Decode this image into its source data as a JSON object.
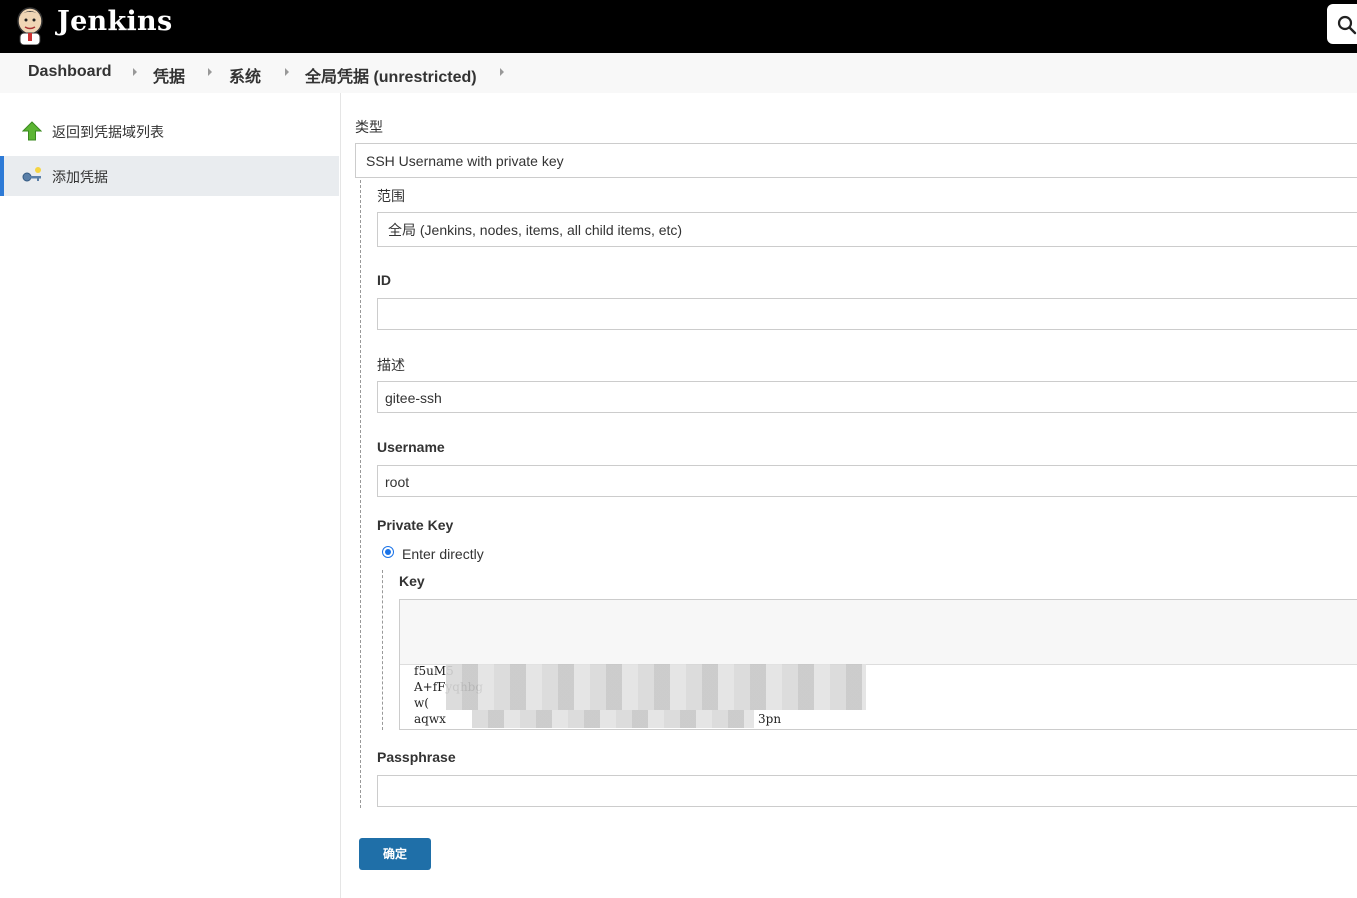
{
  "header": {
    "brand": "Jenkins"
  },
  "breadcrumb": {
    "items": [
      "Dashboard",
      "凭据",
      "系统",
      "全局凭据 (unrestricted)"
    ]
  },
  "sidebar": {
    "items": [
      {
        "label": "返回到凭据域列表",
        "icon": "up-arrow-icon"
      },
      {
        "label": "添加凭据",
        "icon": "key-icon",
        "active": true
      }
    ]
  },
  "form": {
    "kind_label": "类型",
    "kind_value": "SSH Username with private key",
    "scope_label": "范围",
    "scope_value": "全局 (Jenkins, nodes, items, all child items, etc)",
    "id_label": "ID",
    "id_value": "",
    "description_label": "描述",
    "description_value": "gitee-ssh",
    "username_label": "Username",
    "username_value": "root",
    "private_key_label": "Private Key",
    "enter_directly_label": "Enter directly",
    "key_label": "Key",
    "key_lines": [
      "f5uM5",
      "A+fFyqhbg",
      "w(",
      "aqwx"
    ],
    "key_line_tail": "3pn",
    "passphrase_label": "Passphrase",
    "passphrase_value": "",
    "submit_label": "确定"
  },
  "colors": {
    "header_bg": "#000000",
    "accent": "#2d7ad6",
    "submit_bg": "#1f6fa8"
  }
}
